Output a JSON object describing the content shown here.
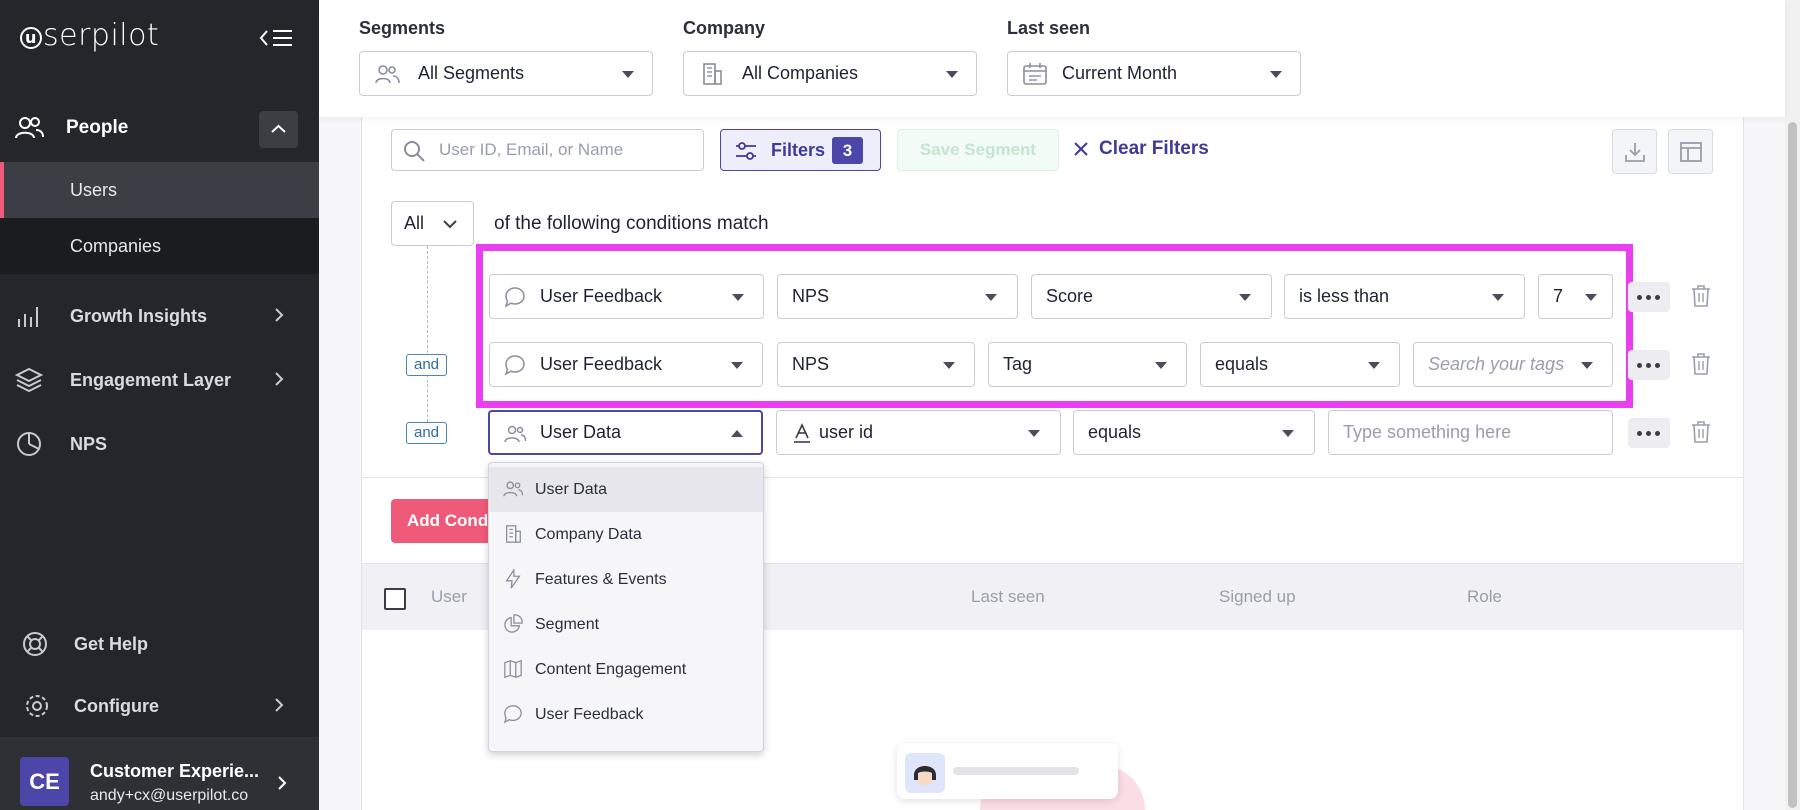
{
  "sidebar": {
    "logo": "serpilot",
    "logo_mark": "u",
    "people_label": "People",
    "sub_items": [
      "Users",
      "Companies"
    ],
    "nav_items": [
      "Growth Insights",
      "Engagement Layer",
      "NPS"
    ],
    "help_label": "Get Help",
    "configure_label": "Configure",
    "user": {
      "initials": "CE",
      "name": "Customer Experie...",
      "email": "andy+cx@userpilot.co"
    }
  },
  "topbar": {
    "segments_label": "Segments",
    "segments_value": "All Segments",
    "company_label": "Company",
    "company_value": "All Companies",
    "lastseen_label": "Last seen",
    "lastseen_value": "Current Month"
  },
  "toolbar": {
    "search_placeholder": "User ID, Email, or Name",
    "filters_label": "Filters",
    "filters_count": "3",
    "save_segment": "Save Segment",
    "clear_filters": "Clear Filters"
  },
  "conditions": {
    "match_mode": "All",
    "match_text": "of the following conditions match",
    "and_label": "and",
    "rows": [
      {
        "source": "User Feedback",
        "type": "NPS",
        "field": "Score",
        "operator": "is less than",
        "value": "7"
      },
      {
        "source": "User Feedback",
        "type": "NPS",
        "field": "Tag",
        "operator": "equals",
        "value_placeholder": "Search your tags"
      },
      {
        "source": "User Data",
        "field": "user id",
        "operator": "equals",
        "value_placeholder": "Type something here"
      }
    ]
  },
  "add_condition": "Add Condi",
  "table": {
    "columns": [
      "User",
      "Last seen",
      "Signed up",
      "Role"
    ]
  },
  "dropdown": {
    "options": [
      "User Data",
      "Company Data",
      "Features & Events",
      "Segment",
      "Content Engagement",
      "User Feedback"
    ],
    "selected": "User Data"
  },
  "colors": {
    "accent": "#4b46a8",
    "highlight": "#ea3ff0",
    "brand_pink": "#ef5a7a",
    "sidebar_bg": "#24262b"
  }
}
